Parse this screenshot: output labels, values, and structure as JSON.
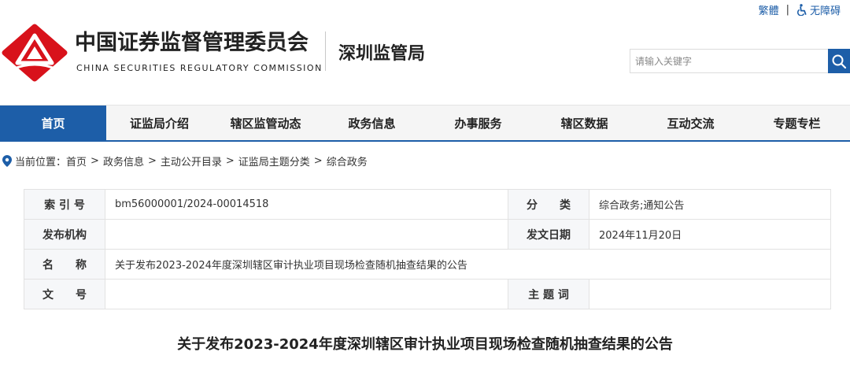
{
  "top_links": {
    "traditional": "繁體",
    "separator": "|",
    "accessibility": "无障碍",
    "accessibility_icon": "wheelchair-icon"
  },
  "header": {
    "logo_icon": "csrc-logo",
    "org_name_cn": "中国证券监督管理委员会",
    "org_name_en": "CHINA SECURITIES REGULATORY COMMISSION",
    "bureau": "深圳监管局"
  },
  "search": {
    "placeholder": "请输入关键字",
    "value": "",
    "icon": "search-icon"
  },
  "nav": {
    "items": [
      {
        "label": "首页",
        "active": true
      },
      {
        "label": "证监局介绍",
        "active": false
      },
      {
        "label": "辖区监管动态",
        "active": false
      },
      {
        "label": "政务信息",
        "active": false
      },
      {
        "label": "办事服务",
        "active": false
      },
      {
        "label": "辖区数据",
        "active": false
      },
      {
        "label": "互动交流",
        "active": false
      },
      {
        "label": "专题专栏",
        "active": false
      }
    ]
  },
  "breadcrumb": {
    "icon": "location-pin-icon",
    "prefix": "当前位置：",
    "separator": ">",
    "items": [
      "首页",
      "政务信息",
      "主动公开目录",
      "证监局主题分类",
      "综合政务"
    ]
  },
  "meta": {
    "index_no": {
      "label": "索 引 号",
      "value": "bm56000001/2024-00014518"
    },
    "category": {
      "label": "分　　类",
      "value": "综合政务;通知公告"
    },
    "publisher": {
      "label": "发布机构",
      "value": ""
    },
    "date": {
      "label": "发文日期",
      "value": "2024年11月20日"
    },
    "name": {
      "label": "名　　称",
      "value": "关于发布2023-2024年度深圳辖区审计执业项目现场检查随机抽查结果的公告"
    },
    "doc_no": {
      "label": "文　　号",
      "value": ""
    },
    "keywords": {
      "label": "主 题 词",
      "value": ""
    }
  },
  "article": {
    "title": "关于发布2023-2024年度深圳辖区审计执业项目现场检查随机抽查结果的公告"
  },
  "colors": {
    "primary": "#1d5ea8",
    "logo_red": "#d8121b",
    "nav_bg": "#f5f5f5",
    "label_bg": "#f6f7f9"
  }
}
